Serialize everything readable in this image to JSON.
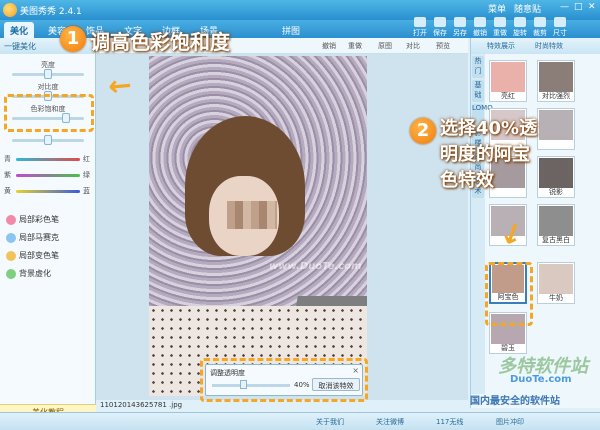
{
  "app": {
    "title": "美图秀秀 2.4.1",
    "tabs": [
      "美化",
      "美容",
      "饰品",
      "文字",
      "边框",
      "场景",
      "拼图"
    ]
  },
  "top_tools": [
    "打开",
    "保存",
    "另存",
    "撤销",
    "重做",
    "旋转",
    "裁剪",
    "尺寸"
  ],
  "window": {
    "left_links": [
      "菜单",
      "随意贴"
    ]
  },
  "left_panel": {
    "header": "一键美化",
    "sliders": [
      {
        "label": "亮度",
        "value": 50
      },
      {
        "label": "对比度",
        "value": 50
      },
      {
        "label": "色彩饱和度",
        "value": 78
      },
      {
        "label": "",
        "value": 50
      }
    ],
    "color_balance": [
      {
        "left": "青",
        "right": "红",
        "value": 50
      },
      {
        "left": "紫",
        "right": "绿",
        "value": 50
      },
      {
        "left": "黄",
        "right": "蓝",
        "value": 50
      }
    ],
    "brushes": [
      "局部彩色笔",
      "局部马赛克",
      "局部变色笔",
      "背景虚化"
    ],
    "footer": "美化教程"
  },
  "canvas_toolbar": [
    "撤销",
    "重做",
    "原图",
    "对比",
    "预览"
  ],
  "photo": {
    "watermark": "www.DuoTe.com"
  },
  "transparency_popup": {
    "label": "调整透明度",
    "value": "40%",
    "cancel": "取消该特效",
    "close": "×",
    "slider_value": 0.4
  },
  "filename": "110120143625781 .jpg",
  "right_panel": {
    "tabs": [
      "特效展示",
      "时尚特效"
    ],
    "side_tabs": [
      "热门",
      "基础",
      "LOMO",
      "影楼",
      "时尚",
      "艺术"
    ],
    "thumbs": [
      {
        "name": "亮红",
        "color": "#e9b1a9"
      },
      {
        "name": "对比强烈",
        "color": "#8b7d78"
      },
      {
        "name": "",
        "color": "#d6c7c8"
      },
      {
        "name": "",
        "color": "#b7b0b4"
      },
      {
        "name": "",
        "color": "#a59a9d"
      },
      {
        "name": "锐影",
        "color": "#6c6363"
      },
      {
        "name": "",
        "color": "#b8b0b4"
      },
      {
        "name": "复古黑白",
        "color": "#8e8e8e"
      },
      {
        "name": "阿宝色",
        "color": "#c29c8a"
      },
      {
        "name": "牛奶",
        "color": "#d9c9c0"
      },
      {
        "name": "碧玉",
        "color": "#b7a7b0"
      }
    ]
  },
  "annotations": {
    "step1_num": "1",
    "step1_text": "调高色彩饱和度",
    "step2_num": "2",
    "step2_lines": [
      "选择40%透",
      "明度的阿宝",
      "色特效"
    ]
  },
  "statusbar": [
    "关于我们",
    "关注微博",
    "117无线",
    "图片冲印"
  ],
  "site_logo": {
    "l1": "多特软件站",
    "l2": "DuoTe.com",
    "l3": "国内最安全的软件站"
  }
}
